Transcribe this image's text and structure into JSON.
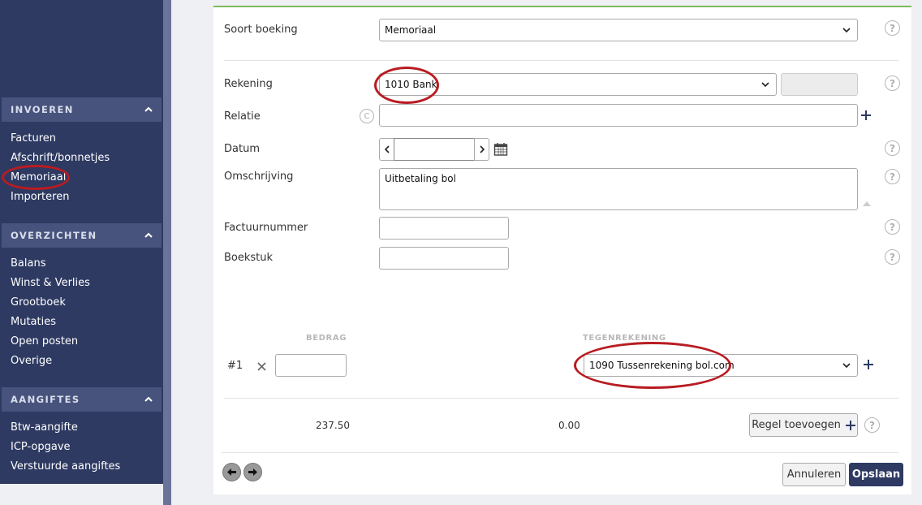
{
  "sidebar": {
    "sections": [
      {
        "title": "INVOEREN",
        "items": [
          "Facturen",
          "Afschrift/bonnetjes",
          "Memoriaal",
          "Importeren"
        ]
      },
      {
        "title": "OVERZICHTEN",
        "items": [
          "Balans",
          "Winst & Verlies",
          "Grootboek",
          "Mutaties",
          "Open posten",
          "Overige"
        ]
      },
      {
        "title": "AANGIFTES",
        "items": [
          "Btw-aangifte",
          "ICP-opgave",
          "Verstuurde aangiftes"
        ]
      }
    ]
  },
  "form": {
    "soort_boeking": {
      "label": "Soort boeking",
      "value": "Memoriaal"
    },
    "rekening": {
      "label": "Rekening",
      "value": "1010 Bank"
    },
    "relatie": {
      "label": "Relatie",
      "value": ""
    },
    "datum": {
      "label": "Datum",
      "value": ""
    },
    "omschrijving": {
      "label": "Omschrijving",
      "value": "Uitbetaling bol"
    },
    "factuurnummer": {
      "label": "Factuurnummer",
      "value": ""
    },
    "boekstuk": {
      "label": "Boekstuk",
      "value": ""
    }
  },
  "lines": {
    "header_bedrag": "BEDRAG",
    "header_tegenrekening": "TEGENREKENING",
    "rows": [
      {
        "number": "#1",
        "bedrag": "",
        "tegenrekening": "1090 Tussenrekening bol.com"
      }
    ],
    "total_bedrag": "237.50",
    "total_tegen": "0.00",
    "add_line_label": "Regel toevoegen"
  },
  "footer": {
    "cancel_label": "Annuleren",
    "save_label": "Opslaan"
  },
  "help_symbol": "?",
  "relatie_badge": "C",
  "accent_color": "#2e3a62",
  "highlight_color": "#b81c22"
}
